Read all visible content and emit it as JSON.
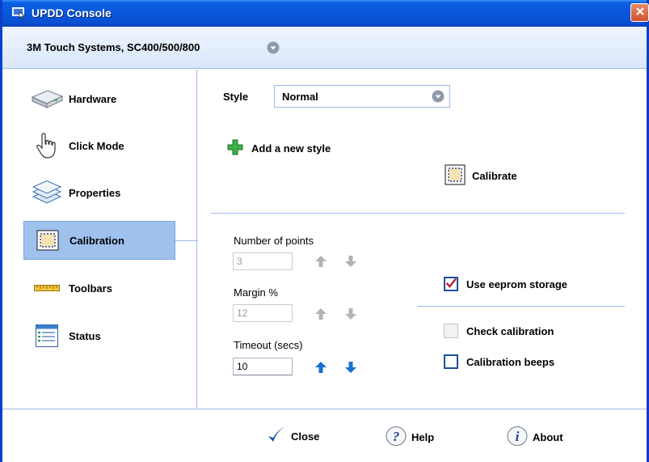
{
  "window": {
    "title": "UPDD Console"
  },
  "device": {
    "name": "3M Touch Systems, SC400/500/800"
  },
  "sidebar": {
    "items": [
      {
        "label": "Hardware",
        "icon": "hardware-icon"
      },
      {
        "label": "Click Mode",
        "icon": "hand-pointer-icon"
      },
      {
        "label": "Properties",
        "icon": "layers-icon"
      },
      {
        "label": "Calibration",
        "icon": "calibration-icon",
        "selected": true
      },
      {
        "label": "Toolbars",
        "icon": "ruler-icon"
      },
      {
        "label": "Status",
        "icon": "status-list-icon"
      }
    ]
  },
  "main": {
    "style_label": "Style",
    "style_value": "Normal",
    "add_style_label": "Add a new style",
    "calibrate_label": "Calibrate",
    "fields": [
      {
        "label": "Number of points",
        "value": "3",
        "enabled": false
      },
      {
        "label": "Margin %",
        "value": "12",
        "enabled": false
      },
      {
        "label": "Timeout (secs)",
        "value": "10",
        "enabled": true
      }
    ],
    "checkboxes": [
      {
        "label": "Use eeprom storage",
        "checked": true,
        "enabled": true
      },
      {
        "label": "Check calibration",
        "checked": false,
        "enabled": false
      },
      {
        "label": "Calibration beeps",
        "checked": false,
        "enabled": true
      }
    ]
  },
  "footer": {
    "close_label": "Close",
    "help_label": "Help",
    "about_label": "About"
  },
  "colors": {
    "titlebar": "#0a56d8",
    "selected_nav": "#9fc1ee",
    "divider": "#9db9e6",
    "arrow_active": "#1a6fd1",
    "arrow_disabled": "#b3b3b3",
    "check_red": "#c0202a"
  }
}
